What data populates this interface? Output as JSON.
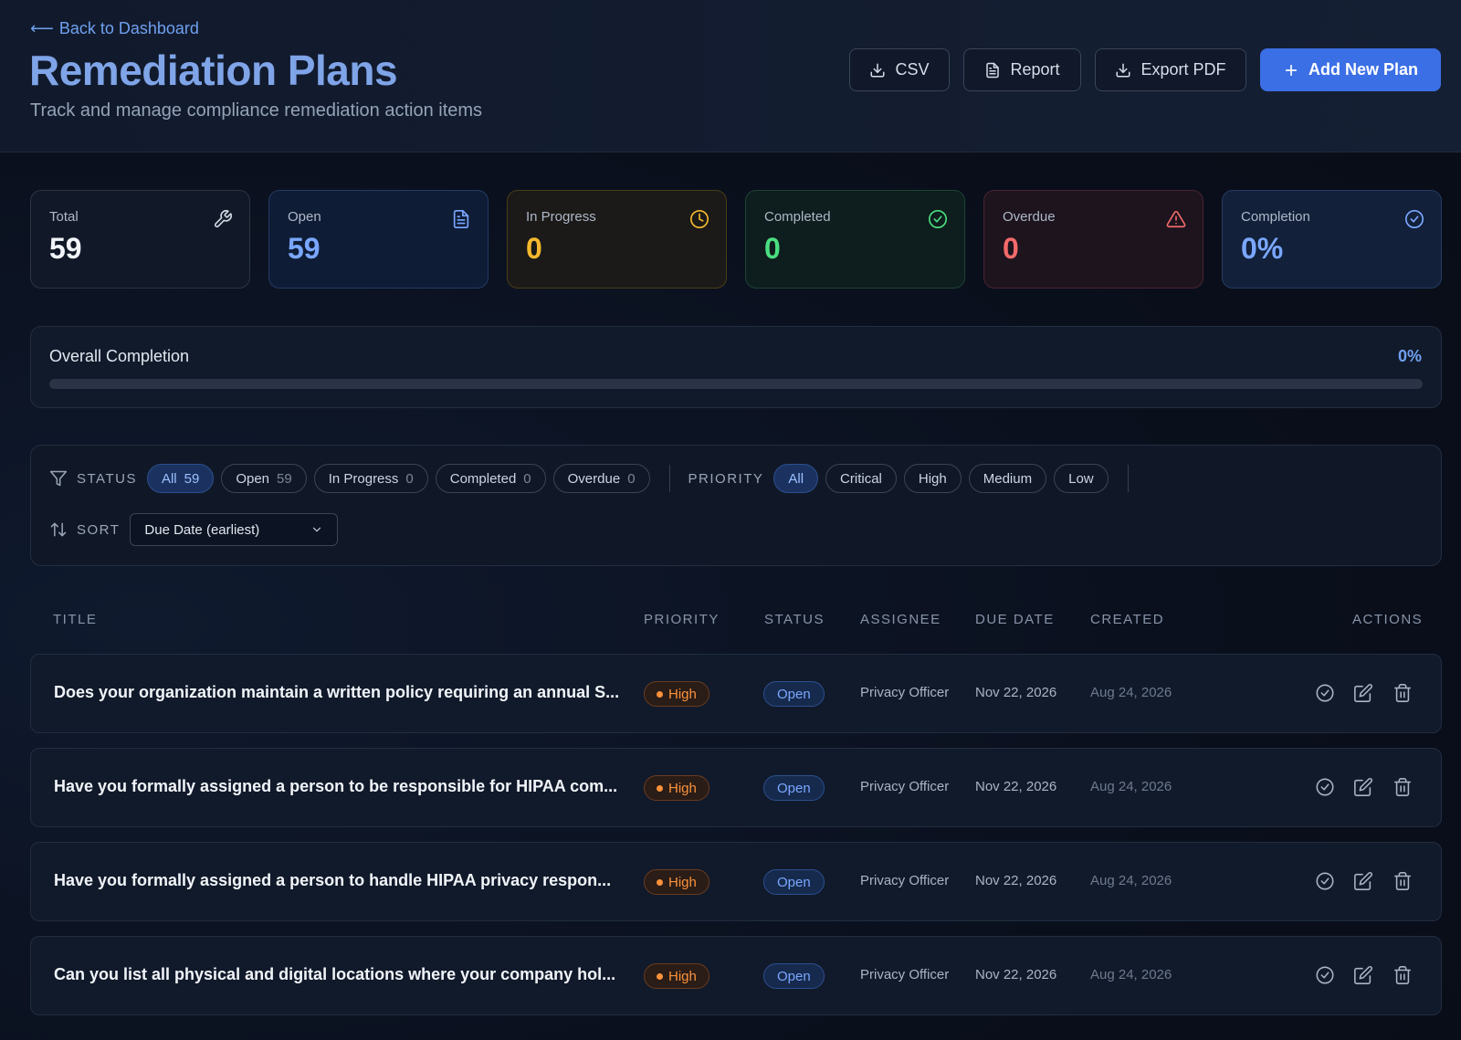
{
  "header": {
    "back_label": "Back to Dashboard",
    "title": "Remediation Plans",
    "subtitle": "Track and manage compliance remediation action items",
    "buttons": {
      "csv": "CSV",
      "report": "Report",
      "export_pdf": "Export PDF",
      "add": "Add New Plan"
    }
  },
  "stats": [
    {
      "label": "Total",
      "value": "59",
      "icon": "wrench-icon"
    },
    {
      "label": "Open",
      "value": "59",
      "icon": "document-icon"
    },
    {
      "label": "In Progress",
      "value": "0",
      "icon": "clock-icon"
    },
    {
      "label": "Completed",
      "value": "0",
      "icon": "check-circle-icon"
    },
    {
      "label": "Overdue",
      "value": "0",
      "icon": "warning-triangle-icon"
    },
    {
      "label": "Completion",
      "value": "0%",
      "icon": "check-circle-icon"
    }
  ],
  "overall": {
    "label": "Overall Completion",
    "percent_text": "0%",
    "progress_fraction": 0
  },
  "filters": {
    "status_label": "STATUS",
    "status_chips": [
      {
        "label": "All",
        "count": "59"
      },
      {
        "label": "Open",
        "count": "59"
      },
      {
        "label": "In Progress",
        "count": "0"
      },
      {
        "label": "Completed",
        "count": "0"
      },
      {
        "label": "Overdue",
        "count": "0"
      }
    ],
    "priority_label": "PRIORITY",
    "priority_chips": [
      "All",
      "Critical",
      "High",
      "Medium",
      "Low"
    ],
    "sort_label": "SORT",
    "sort_value": "Due Date (earliest)"
  },
  "table": {
    "headers": {
      "title": "TITLE",
      "priority": "PRIORITY",
      "status": "STATUS",
      "assignee": "ASSIGNEE",
      "due": "DUE DATE",
      "created": "CREATED",
      "actions": "ACTIONS"
    },
    "rows": [
      {
        "title": "Does your organization maintain a written policy requiring an annual S...",
        "priority": "High",
        "status": "Open",
        "assignee": "Privacy Officer",
        "due": "Nov 22, 2026",
        "created": "Aug 24, 2026"
      },
      {
        "title": "Have you formally assigned a person to be responsible for HIPAA com...",
        "priority": "High",
        "status": "Open",
        "assignee": "Privacy Officer",
        "due": "Nov 22, 2026",
        "created": "Aug 24, 2026"
      },
      {
        "title": "Have you formally assigned a person to handle HIPAA privacy respon...",
        "priority": "High",
        "status": "Open",
        "assignee": "Privacy Officer",
        "due": "Nov 22, 2026",
        "created": "Aug 24, 2026"
      },
      {
        "title": "Can you list all physical and digital locations where your company hol...",
        "priority": "High",
        "status": "Open",
        "assignee": "Privacy Officer",
        "due": "Nov 22, 2026",
        "created": "Aug 24, 2026"
      }
    ]
  }
}
